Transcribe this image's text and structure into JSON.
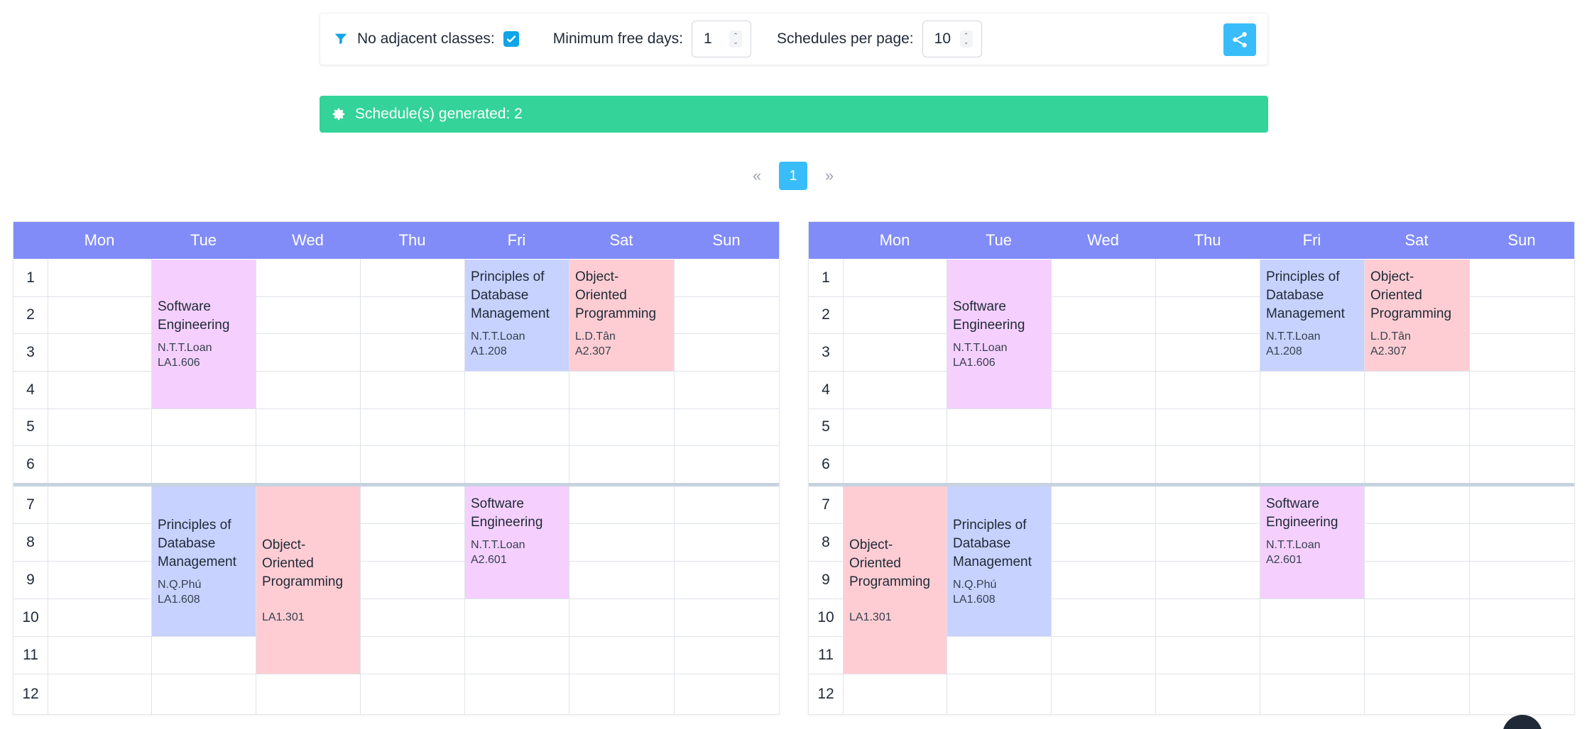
{
  "options": {
    "adjacent_label": "No adjacent classes:",
    "adjacent_checked": true,
    "free_days_label": "Minimum free days:",
    "free_days_value": "1",
    "per_page_label": "Schedules per page:",
    "per_page_value": "10"
  },
  "banner": {
    "text": "Schedule(s) generated: 2"
  },
  "pagination": {
    "prev": "«",
    "current": "1",
    "next": "»"
  },
  "days": [
    "Mon",
    "Tue",
    "Wed",
    "Thu",
    "Fri",
    "Sat",
    "Sun"
  ],
  "periods": [
    "1",
    "2",
    "3",
    "4",
    "5",
    "6",
    "7",
    "8",
    "9",
    "10",
    "11",
    "12"
  ],
  "schedules": [
    {
      "courses": [
        {
          "name": "Software Engineering",
          "lecturer": "N.T.T.Loan",
          "room": "LA1.606"
        },
        {
          "name": "Principles of Database Management",
          "lecturer": "N.T.T.Loan",
          "room": "A1.208"
        },
        {
          "name": "Object-Oriented Programming",
          "lecturer": "L.D.Tân",
          "room": "A2.307"
        },
        {
          "name": "Principles of Database Management",
          "lecturer": "N.Q.Phú",
          "room": "LA1.608"
        },
        {
          "name": "Object-Oriented Programming",
          "lecturer": "",
          "room": "LA1.301"
        },
        {
          "name": "Software Engineering",
          "lecturer": "N.T.T.Loan",
          "room": "A2.601"
        }
      ]
    },
    {
      "courses": [
        {
          "name": "Software Engineering",
          "lecturer": "N.T.T.Loan",
          "room": "LA1.606"
        },
        {
          "name": "Principles of Database Management",
          "lecturer": "N.T.T.Loan",
          "room": "A1.208"
        },
        {
          "name": "Object-Oriented Programming",
          "lecturer": "L.D.Tân",
          "room": "A2.307"
        },
        {
          "name": "Object-Oriented Programming",
          "lecturer": "",
          "room": "LA1.301"
        },
        {
          "name": "Principles of Database Management",
          "lecturer": "N.Q.Phú",
          "room": "LA1.608"
        },
        {
          "name": "Software Engineering",
          "lecturer": "N.T.T.Loan",
          "room": "A2.601"
        }
      ]
    }
  ]
}
